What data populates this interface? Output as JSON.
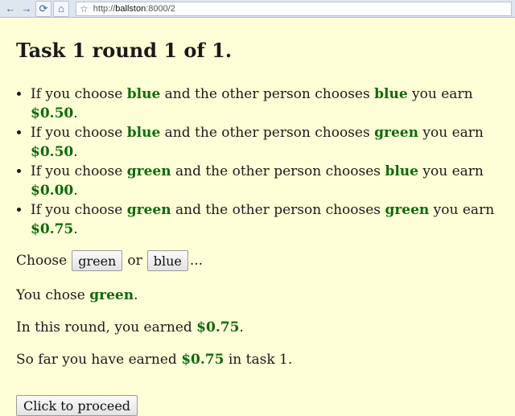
{
  "browser": {
    "back_icon": "arrow-left",
    "forward_icon": "arrow-right",
    "reload_icon": "reload",
    "home_icon": "home",
    "bookmark_icon": "star",
    "url_prefix": "http://",
    "url_host": "ballston",
    "url_rest": ":8000/2"
  },
  "page": {
    "title": "Task 1 round 1 of 1.",
    "rules": [
      {
        "t1": "If you choose ",
        "you": "blue",
        "t2": " and the other person chooses ",
        "other": "blue",
        "t3": " you earn ",
        "amount": "$0.50",
        "t4": "."
      },
      {
        "t1": "If you choose ",
        "you": "blue",
        "t2": " and the other person chooses ",
        "other": "green",
        "t3": " you earn ",
        "amount": "$0.50",
        "t4": "."
      },
      {
        "t1": "If you choose ",
        "you": "green",
        "t2": " and the other person chooses ",
        "other": "blue",
        "t3": " you earn ",
        "amount": "$0.00",
        "t4": "."
      },
      {
        "t1": "If you choose ",
        "you": "green",
        "t2": " and the other person chooses ",
        "other": "green",
        "t3": " you earn ",
        "amount": "$0.75",
        "t4": "."
      }
    ],
    "choose_label": "Choose",
    "or_label": "or",
    "ellipsis": "...",
    "option_green": "green",
    "option_blue": "blue",
    "chose_prefix": "You chose ",
    "chose_value": "green",
    "chose_suffix": ".",
    "earned_prefix": "In this round, you earned ",
    "earned_value": "$0.75",
    "earned_suffix": ".",
    "sofar_prefix": "So far you have earned ",
    "sofar_value": "$0.75",
    "sofar_suffix": " in task 1.",
    "proceed_label": "Click to proceed"
  },
  "colors": {
    "page_background": "#ffffd7",
    "highlight_green": "#0c6b0c"
  }
}
